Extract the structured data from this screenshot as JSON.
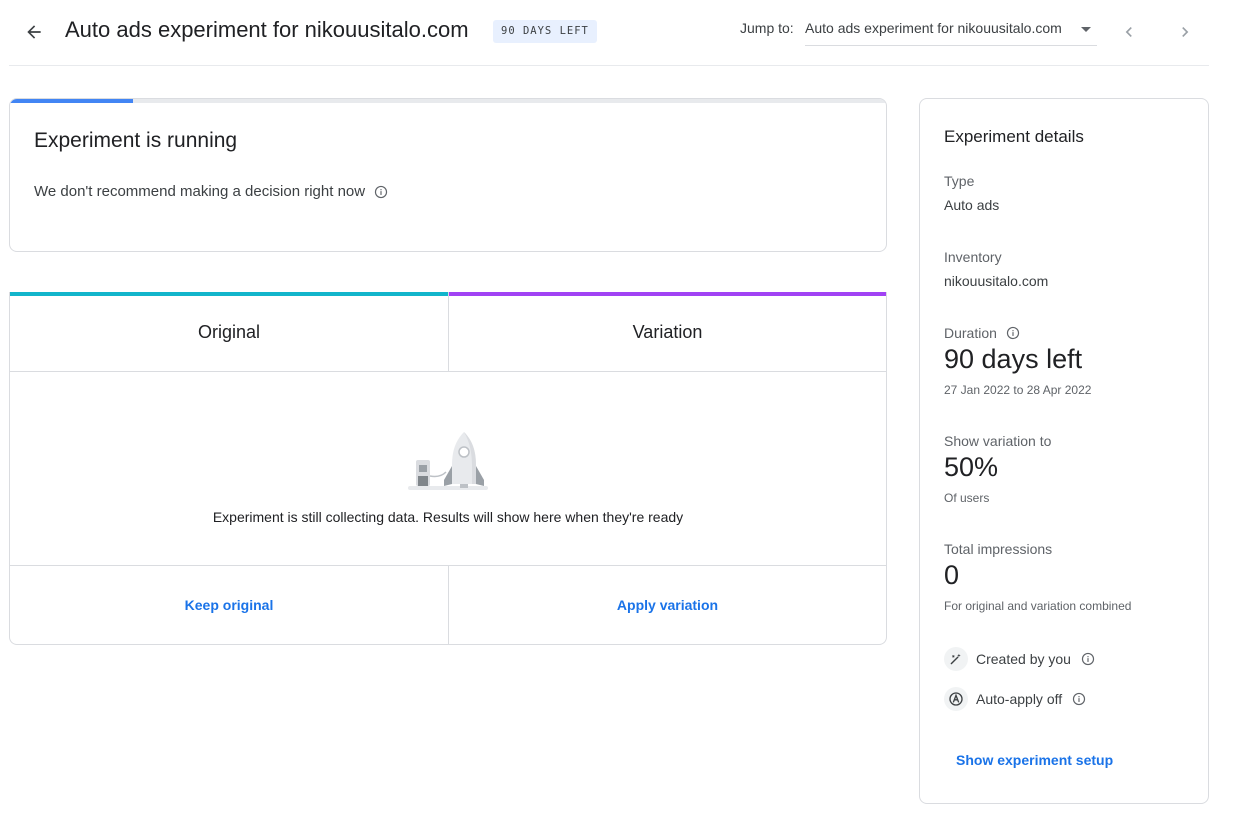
{
  "header": {
    "title": "Auto ads experiment for nikouusitalo.com",
    "badge": "90 DAYS LEFT",
    "jump_label": "Jump to:",
    "jump_value": "Auto ads experiment for nikouusitalo.com"
  },
  "status": {
    "title": "Experiment is running",
    "subtitle": "We don't recommend making a decision right now",
    "progress_fraction": 0.14
  },
  "comparison": {
    "original_label": "Original",
    "variation_label": "Variation",
    "original_color": "#12b5cb",
    "variation_color": "#a142f4",
    "empty_message": "Experiment is still collecting data. Results will show here when they're ready",
    "keep_label": "Keep original",
    "apply_label": "Apply variation"
  },
  "details": {
    "heading": "Experiment details",
    "type_label": "Type",
    "type_value": "Auto ads",
    "inventory_label": "Inventory",
    "inventory_value": "nikouusitalo.com",
    "duration_label": "Duration",
    "duration_value": "90 days left",
    "duration_range": "27 Jan 2022 to 28 Apr 2022",
    "show_label": "Show variation to",
    "show_value": "50%",
    "show_sub": "Of users",
    "impressions_label": "Total impressions",
    "impressions_value": "0",
    "impressions_sub": "For original and variation combined",
    "created_label": "Created by you",
    "autoapply_label": "Auto-apply off",
    "setup_link": "Show experiment setup"
  },
  "colors": {
    "accent": "#1a73e8",
    "progress": "#4285f4",
    "badge_bg": "#e8f0fe"
  },
  "icons": [
    "arrow-back-icon",
    "chevron-left-icon",
    "chevron-right-icon",
    "info-icon",
    "rocket-illustration",
    "magic-wand-icon",
    "auto-apply-icon"
  ]
}
